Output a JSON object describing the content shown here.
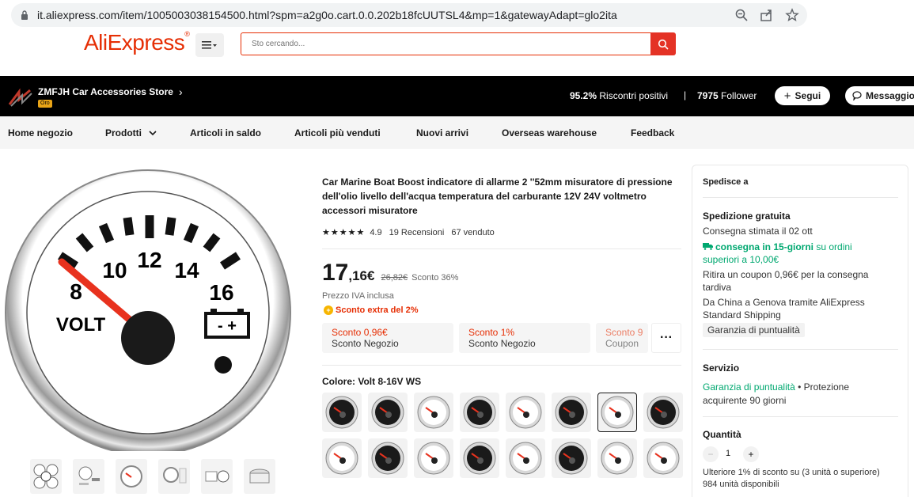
{
  "browser": {
    "url": "it.aliexpress.com/item/1005003038154500.html?spm=a2g0o.cart.0.0.202b18fcUUTSL4&mp=1&gatewayAdapt=glo2ita"
  },
  "header": {
    "logo_text": "AliExpress",
    "logo_mark": "®",
    "search_placeholder": "Sto cercando...",
    "accent_color": "#e62e04"
  },
  "store": {
    "name": "ZMFJH Car Accessories Store",
    "badge": "Oro",
    "feedback_value": "95.2%",
    "feedback_label": "Riscontri positivi",
    "separator": "|",
    "followers_value": "7975",
    "followers_label": "Follower",
    "follow_label": "Segui",
    "message_label": "Messaggio"
  },
  "nav": {
    "items": [
      "Home negozio",
      "Prodotti",
      "Articoli in saldo",
      "Articoli più venduti",
      "Nuovi arrivi",
      "Overseas warehouse",
      "Feedback"
    ]
  },
  "product": {
    "title": "Car Marine Boat Boost indicatore di allarme 2 ''52mm misuratore di pressione dell'olio livello dell'acqua temperatura del carburante 12V 24V voltmetro accessori misuratore",
    "gauge_labels": [
      "8",
      "10",
      "12",
      "14",
      "16",
      "VOLT",
      "- +"
    ],
    "stars": "★★★★★",
    "rating": "4.9",
    "reviews": "19 Recensioni",
    "sold": "67 venduto",
    "price_int": "17",
    "price_dec": ",16€",
    "old_price": "26,82€",
    "discount": "Sconto 36%",
    "vat": "Prezzo IVA inclusa",
    "extra_discount": "Sconto extra del 2%",
    "extra_icon": "+",
    "coupons": [
      {
        "value": "Sconto 0,96€",
        "label": "Sconto Negozio"
      },
      {
        "value": "Sconto 1%",
        "label": "Sconto Negozio"
      },
      {
        "value": "Sconto 9",
        "label": "Coupon"
      }
    ],
    "more_label": "···",
    "color_label": "Colore: Volt 8-16V WS"
  },
  "shipping": {
    "ship_to": "Spedisce a",
    "free_title": "Spedizione gratuita",
    "estimate": "Consegna stimata il 02 ott",
    "fast_bold": "consegna in 15-giorni",
    "fast_rest": " su ordini",
    "fast_line2": "superiori a 10,00€",
    "coupon_line1": "Ritira un coupon 0,96€ per la consegna",
    "coupon_line2": "tardiva",
    "route_line1": "Da China a Genova tramite AliExpress",
    "route_line2": "Standard Shipping",
    "guarantee_tag": "Garanzia di puntualità",
    "service_title": "Servizio",
    "service_link": "Garanzia di puntualità",
    "service_rest": " • Protezione",
    "service_line2": "acquirente 90 giorni",
    "qty_title": "Quantità",
    "qty_minus": "−",
    "qty_value": "1",
    "qty_plus": "+",
    "bulk_line": "Ulteriore 1% di sconto su (3 unità o superiore)",
    "available": "984 unità disponibili"
  }
}
